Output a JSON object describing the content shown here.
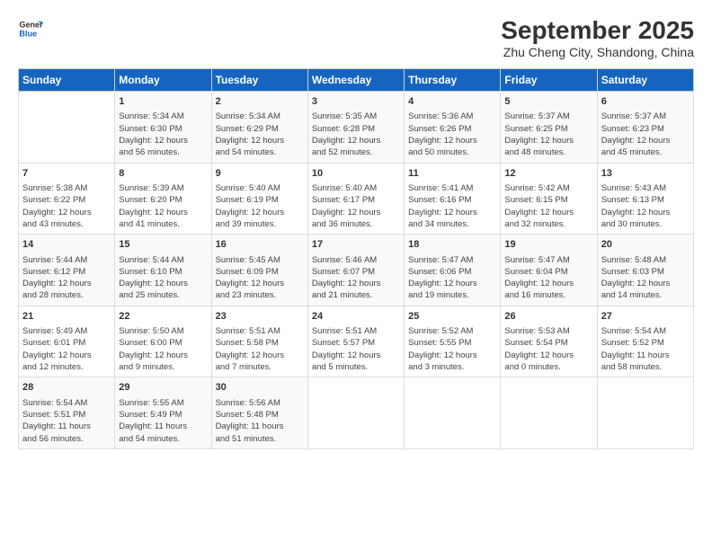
{
  "header": {
    "logo_line1": "General",
    "logo_line2": "Blue",
    "title": "September 2025",
    "subtitle": "Zhu Cheng City, Shandong, China"
  },
  "days_of_week": [
    "Sunday",
    "Monday",
    "Tuesday",
    "Wednesday",
    "Thursday",
    "Friday",
    "Saturday"
  ],
  "weeks": [
    [
      {
        "day": "",
        "info": ""
      },
      {
        "day": "1",
        "info": "Sunrise: 5:34 AM\nSunset: 6:30 PM\nDaylight: 12 hours\nand 56 minutes."
      },
      {
        "day": "2",
        "info": "Sunrise: 5:34 AM\nSunset: 6:29 PM\nDaylight: 12 hours\nand 54 minutes."
      },
      {
        "day": "3",
        "info": "Sunrise: 5:35 AM\nSunset: 6:28 PM\nDaylight: 12 hours\nand 52 minutes."
      },
      {
        "day": "4",
        "info": "Sunrise: 5:36 AM\nSunset: 6:26 PM\nDaylight: 12 hours\nand 50 minutes."
      },
      {
        "day": "5",
        "info": "Sunrise: 5:37 AM\nSunset: 6:25 PM\nDaylight: 12 hours\nand 48 minutes."
      },
      {
        "day": "6",
        "info": "Sunrise: 5:37 AM\nSunset: 6:23 PM\nDaylight: 12 hours\nand 45 minutes."
      }
    ],
    [
      {
        "day": "7",
        "info": "Sunrise: 5:38 AM\nSunset: 6:22 PM\nDaylight: 12 hours\nand 43 minutes."
      },
      {
        "day": "8",
        "info": "Sunrise: 5:39 AM\nSunset: 6:20 PM\nDaylight: 12 hours\nand 41 minutes."
      },
      {
        "day": "9",
        "info": "Sunrise: 5:40 AM\nSunset: 6:19 PM\nDaylight: 12 hours\nand 39 minutes."
      },
      {
        "day": "10",
        "info": "Sunrise: 5:40 AM\nSunset: 6:17 PM\nDaylight: 12 hours\nand 36 minutes."
      },
      {
        "day": "11",
        "info": "Sunrise: 5:41 AM\nSunset: 6:16 PM\nDaylight: 12 hours\nand 34 minutes."
      },
      {
        "day": "12",
        "info": "Sunrise: 5:42 AM\nSunset: 6:15 PM\nDaylight: 12 hours\nand 32 minutes."
      },
      {
        "day": "13",
        "info": "Sunrise: 5:43 AM\nSunset: 6:13 PM\nDaylight: 12 hours\nand 30 minutes."
      }
    ],
    [
      {
        "day": "14",
        "info": "Sunrise: 5:44 AM\nSunset: 6:12 PM\nDaylight: 12 hours\nand 28 minutes."
      },
      {
        "day": "15",
        "info": "Sunrise: 5:44 AM\nSunset: 6:10 PM\nDaylight: 12 hours\nand 25 minutes."
      },
      {
        "day": "16",
        "info": "Sunrise: 5:45 AM\nSunset: 6:09 PM\nDaylight: 12 hours\nand 23 minutes."
      },
      {
        "day": "17",
        "info": "Sunrise: 5:46 AM\nSunset: 6:07 PM\nDaylight: 12 hours\nand 21 minutes."
      },
      {
        "day": "18",
        "info": "Sunrise: 5:47 AM\nSunset: 6:06 PM\nDaylight: 12 hours\nand 19 minutes."
      },
      {
        "day": "19",
        "info": "Sunrise: 5:47 AM\nSunset: 6:04 PM\nDaylight: 12 hours\nand 16 minutes."
      },
      {
        "day": "20",
        "info": "Sunrise: 5:48 AM\nSunset: 6:03 PM\nDaylight: 12 hours\nand 14 minutes."
      }
    ],
    [
      {
        "day": "21",
        "info": "Sunrise: 5:49 AM\nSunset: 6:01 PM\nDaylight: 12 hours\nand 12 minutes."
      },
      {
        "day": "22",
        "info": "Sunrise: 5:50 AM\nSunset: 6:00 PM\nDaylight: 12 hours\nand 9 minutes."
      },
      {
        "day": "23",
        "info": "Sunrise: 5:51 AM\nSunset: 5:58 PM\nDaylight: 12 hours\nand 7 minutes."
      },
      {
        "day": "24",
        "info": "Sunrise: 5:51 AM\nSunset: 5:57 PM\nDaylight: 12 hours\nand 5 minutes."
      },
      {
        "day": "25",
        "info": "Sunrise: 5:52 AM\nSunset: 5:55 PM\nDaylight: 12 hours\nand 3 minutes."
      },
      {
        "day": "26",
        "info": "Sunrise: 5:53 AM\nSunset: 5:54 PM\nDaylight: 12 hours\nand 0 minutes."
      },
      {
        "day": "27",
        "info": "Sunrise: 5:54 AM\nSunset: 5:52 PM\nDaylight: 11 hours\nand 58 minutes."
      }
    ],
    [
      {
        "day": "28",
        "info": "Sunrise: 5:54 AM\nSunset: 5:51 PM\nDaylight: 11 hours\nand 56 minutes."
      },
      {
        "day": "29",
        "info": "Sunrise: 5:55 AM\nSunset: 5:49 PM\nDaylight: 11 hours\nand 54 minutes."
      },
      {
        "day": "30",
        "info": "Sunrise: 5:56 AM\nSunset: 5:48 PM\nDaylight: 11 hours\nand 51 minutes."
      },
      {
        "day": "",
        "info": ""
      },
      {
        "day": "",
        "info": ""
      },
      {
        "day": "",
        "info": ""
      },
      {
        "day": "",
        "info": ""
      }
    ]
  ]
}
